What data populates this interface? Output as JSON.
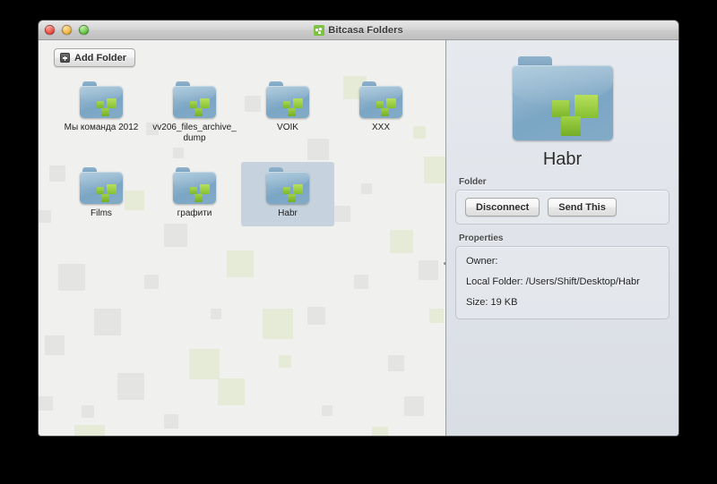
{
  "window": {
    "title": "Bitcasa Folders",
    "app_icon": "bitcasa-logo-icon",
    "controls": {
      "close": "close-button",
      "minimize": "minimize-button",
      "zoom": "zoom-button"
    }
  },
  "toolbar": {
    "add_folder_label": "Add Folder",
    "add_folder_icon": "add-square-icon"
  },
  "folders": [
    {
      "name": "Мы команда 2012",
      "selected": false
    },
    {
      "name": "vv206_files_archive_dump",
      "selected": false
    },
    {
      "name": "VOIK",
      "selected": false
    },
    {
      "name": "XXX",
      "selected": false
    },
    {
      "name": "Films",
      "selected": false
    },
    {
      "name": "графити",
      "selected": false
    },
    {
      "name": "Habr",
      "selected": true
    }
  ],
  "detail": {
    "icon": "folder-icon",
    "title": "Habr",
    "folder_section": {
      "label": "Folder",
      "disconnect_label": "Disconnect",
      "send_this_label": "Send This"
    },
    "properties_section": {
      "label": "Properties",
      "rows": [
        "Owner:",
        "Local Folder: /Users/Shift/Desktop/Habr",
        "Size: 19 KB"
      ]
    }
  },
  "colors": {
    "folder_blue": "#8ab0cb",
    "accent_green": "#8ac53e",
    "selection": "#c6d2dd",
    "right_panel": "#e0e4ea"
  }
}
